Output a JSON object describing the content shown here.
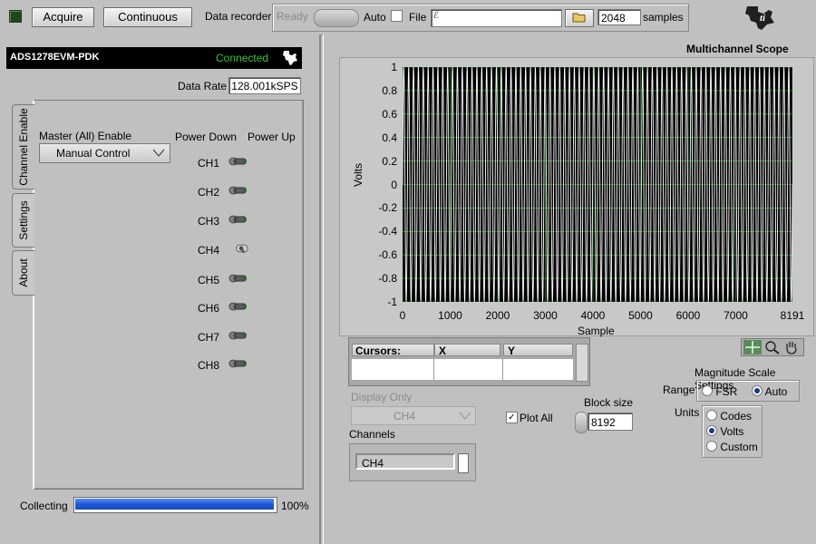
{
  "toolbar": {
    "acquire_label": "Acquire",
    "continuous_label": "Continuous",
    "data_recorder_label": "Data recorder",
    "ready_label": "Ready",
    "auto_label": "Auto",
    "file_label": "File",
    "file_path_value": "",
    "samples_value": "2048",
    "samples_label": "samples"
  },
  "device": {
    "name": "ADS1278EVM-PDK",
    "status": "Connected",
    "status_color": "#2ec82e"
  },
  "data_rate": {
    "label": "Data Rate",
    "value": "128.001kSPS"
  },
  "tabs": [
    {
      "label": "Channel Enable",
      "selected": true
    },
    {
      "label": "Settings",
      "selected": false
    },
    {
      "label": "About",
      "selected": false
    }
  ],
  "channel_enable": {
    "master_label": "Master (All) Enable",
    "master_value": "Manual Control",
    "power_down_label": "Power Down",
    "power_up_label": "Power Up",
    "channels": [
      {
        "label": "CH1",
        "state": "down"
      },
      {
        "label": "CH2",
        "state": "down"
      },
      {
        "label": "CH3",
        "state": "down"
      },
      {
        "label": "CH4",
        "state": "up"
      },
      {
        "label": "CH5",
        "state": "down"
      },
      {
        "label": "CH6",
        "state": "down"
      },
      {
        "label": "CH7",
        "state": "down"
      },
      {
        "label": "CH8",
        "state": "down"
      }
    ]
  },
  "collecting": {
    "label": "Collecting",
    "progress": 1.0,
    "percent_text": "100%",
    "bar_color": "#1e5ad8"
  },
  "scope": {
    "title": "Multichannel Scope",
    "ylabel": "Volts",
    "xlabel": "Sample",
    "yticks": [
      "1",
      "0.8",
      "0.6",
      "0.4",
      "0.2",
      "0",
      "-0.2",
      "-0.4",
      "-0.6",
      "-0.8",
      "-1"
    ],
    "xticks": [
      "0",
      "1000",
      "2000",
      "3000",
      "4000",
      "5000",
      "6000",
      "7000",
      "8191"
    ],
    "trace_color": "#ffffff",
    "grid_color": "#2aa52a"
  },
  "chart_data": {
    "type": "line",
    "title": "Multichannel Scope",
    "xlabel": "Sample",
    "ylabel": "Volts",
    "xlim": [
      0,
      8191
    ],
    "ylim": [
      -1,
      1
    ],
    "series": [
      {
        "name": "CH4",
        "waveform": "sine",
        "amplitude": 1.0,
        "cycles": 80
      }
    ],
    "grid": true
  },
  "cursors": {
    "col_cursors": "Cursors:",
    "col_x": "X",
    "col_y": "Y"
  },
  "display": {
    "label": "Display Only",
    "value": "CH4",
    "plot_all_label": "Plot All",
    "plot_all_checked": true,
    "block_size_label": "Block size",
    "block_size_value": "8192",
    "channels_label": "Channels",
    "channels_value": "CH4"
  },
  "magnitude": {
    "title": "Magnitude Scale Settings",
    "range_label": "Range",
    "range_options": [
      "FSR",
      "Auto"
    ],
    "range_selected": "Auto",
    "units_label": "Units",
    "units_options": [
      "Codes",
      "Volts",
      "Custom"
    ],
    "units_selected": "Volts"
  },
  "icons": {
    "led": "led-indicator-icon",
    "folder": "folder-icon",
    "ti_logo": "ti-logo-icon",
    "zoom": "zoom-icon",
    "pan": "hand-pan-icon",
    "crosshair": "crosshair-cursor-icon"
  }
}
